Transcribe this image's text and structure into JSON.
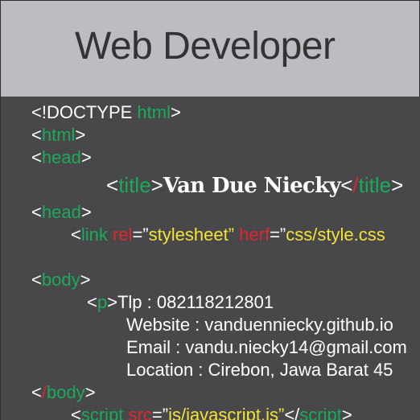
{
  "header": {
    "title": "Web Developer"
  },
  "code": {
    "doctype_prefix": "<!DOCTYPE ",
    "doctype_name": "html",
    "lt": "<",
    "gt": ">",
    "lt_slash": "</",
    "html_tag": "html",
    "head_tag": "head",
    "title_tag": "title",
    "title_text": "Van Due Niecky",
    "link_tag": "link",
    "rel_attr": "rel",
    "eq_quote": "=”",
    "rel_value": "stylesheet”",
    "herf_attr": " herf",
    "herf_value": "css/style.css",
    "body_tag": "body",
    "p_tag": "p",
    "tlp_line": "Tlp : 082118212801",
    "website_line": "Website : vanduenniecky.github.io",
    "email_line": "Email : vandu.niecky14@gmail.com",
    "location_line": "Location : Cirebon, Jawa Barat 45",
    "script_tag": "script",
    "src_attr": "src",
    "src_value": "js/javascript.js”",
    "space": " "
  }
}
